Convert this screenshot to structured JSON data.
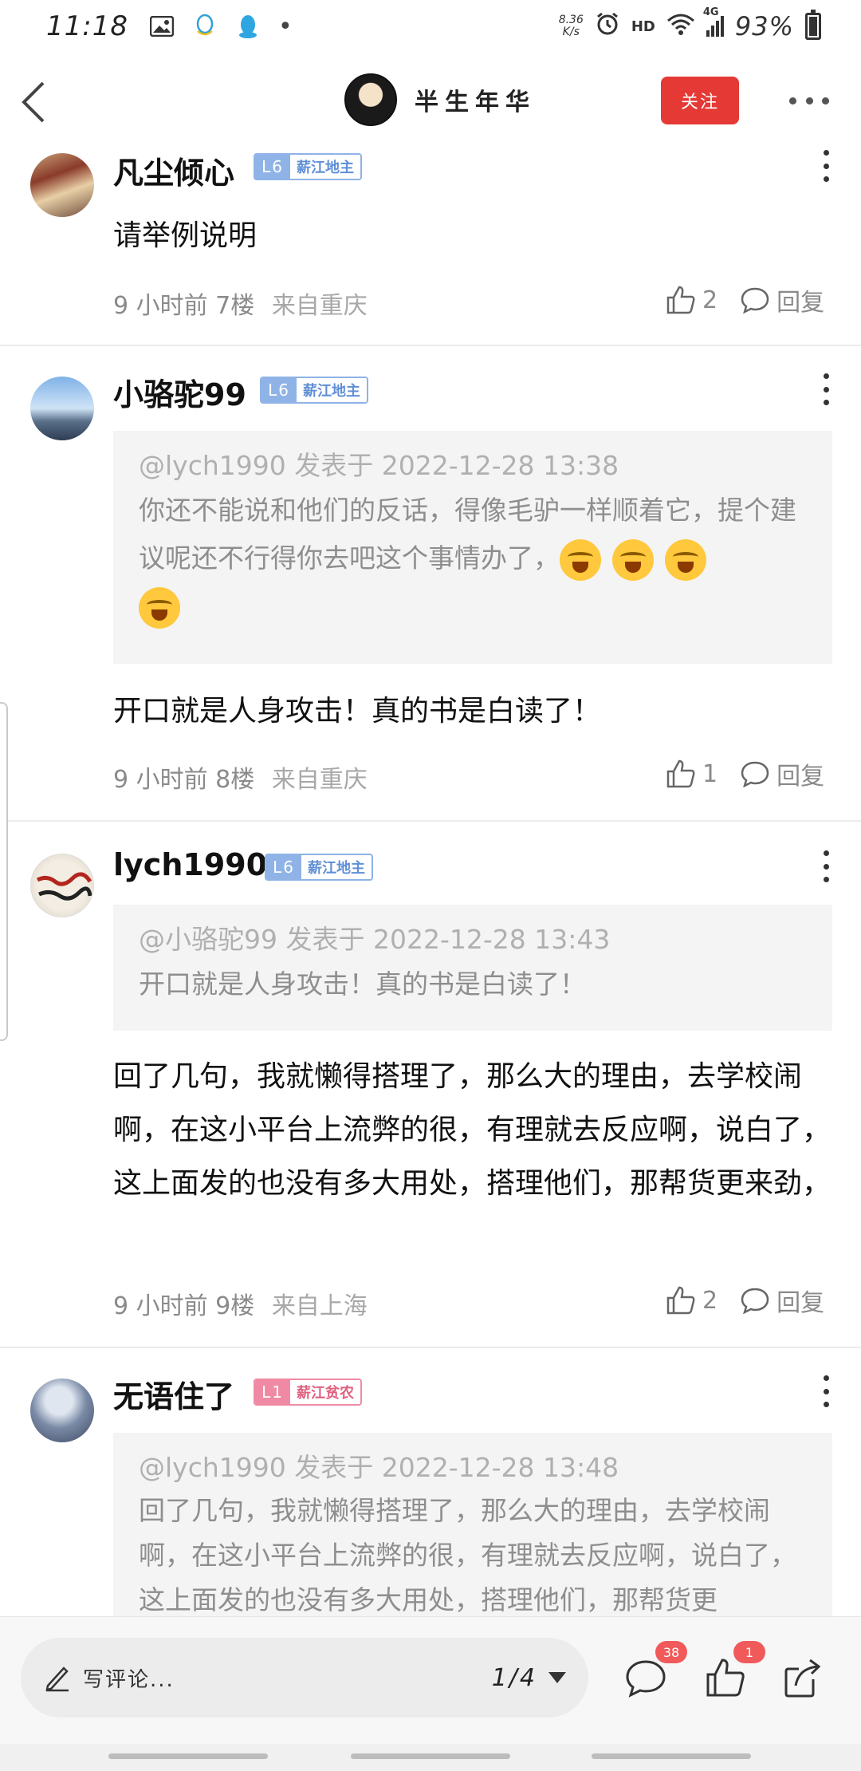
{
  "status_bar": {
    "time": "11:18",
    "left_icons": [
      "image-icon",
      "qq-outline-icon",
      "qq-icon"
    ],
    "dot": "•",
    "net_speed_value": "8.36",
    "net_speed_unit": "K/s",
    "alarm": "alarm-icon",
    "hd": "HD",
    "signal_type": "4G",
    "battery": "93%"
  },
  "header": {
    "title": "半生年华",
    "follow_label": "关注"
  },
  "comments": [
    {
      "name": "凡尘倾心",
      "level": "L6",
      "title": "薪江地主",
      "badge_color": "blue",
      "quote": null,
      "text": "请举例说明",
      "time": "9 小时前",
      "floor": "7楼",
      "location": "来自重庆",
      "likes": "2",
      "reply_label": "回复"
    },
    {
      "name": "小骆驼99",
      "level": "L6",
      "title": "薪江地主",
      "badge_color": "blue",
      "quote": {
        "header": "@lych1990 发表于 2022-12-28 13:38",
        "body": "你还不能说和他们的反话，得像毛驴一样顺着它，提个建议呢还不行得你去吧这个事情办了，",
        "emoji_count": 4
      },
      "text": "开口就是人身攻击！真的书是白读了！",
      "time": "9 小时前",
      "floor": "8楼",
      "location": "来自重庆",
      "likes": "1",
      "reply_label": "回复"
    },
    {
      "name": "lych1990",
      "level": "L6",
      "title": "薪江地主",
      "badge_color": "blue",
      "quote": {
        "header": "@小骆驼99 发表于 2022-12-28 13:43",
        "body": "开口就是人身攻击！真的书是白读了！"
      },
      "text": "回了几句，我就懒得搭理了，那么大的理由，去学校闹啊，在这小平台上流弊的很，有理就去反应啊，说白了，这上面发的也没有多大用处，搭理他们，那帮货更来劲，",
      "time": "9 小时前",
      "floor": "9楼",
      "location": "来自上海",
      "likes": "2",
      "reply_label": "回复"
    },
    {
      "name": "无语住了",
      "level": "L1",
      "title": "薪江贫农",
      "badge_color": "pink",
      "quote": {
        "header": "@lych1990 发表于 2022-12-28 13:48",
        "body": "回了几句，我就懒得搭理了，那么大的理由，去学校闹啊，在这小平台上流弊的很，有理就去反应啊，说白了，这上面发的也没有多大用处，搭理他们，那帮货更"
      }
    }
  ],
  "bottom_bar": {
    "placeholder": "写评论...",
    "page": "1/4",
    "comment_count": "38",
    "like_count": "1"
  }
}
